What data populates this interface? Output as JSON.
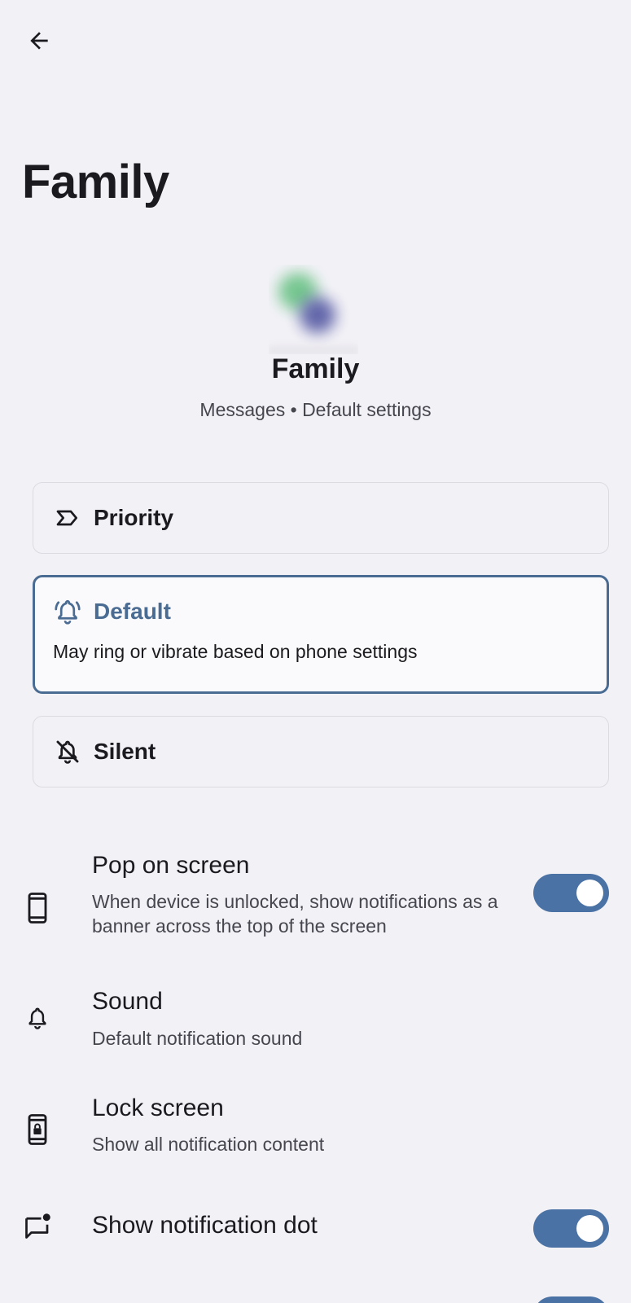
{
  "header": {
    "back_icon": "arrow-back-icon",
    "title": "Family"
  },
  "contact": {
    "name": "Family",
    "subtitle": "Messages • Default settings"
  },
  "importance": {
    "options": [
      {
        "label": "Priority",
        "icon": "priority-icon",
        "selected": false
      },
      {
        "label": "Default",
        "icon": "bell-ring-icon",
        "selected": true,
        "description": "May ring or vibrate based on phone settings"
      },
      {
        "label": "Silent",
        "icon": "bell-off-icon",
        "selected": false
      }
    ]
  },
  "settings": {
    "pop_on_screen": {
      "title": "Pop on screen",
      "subtitle": "When device is unlocked, show notifications as a banner across the top of the screen",
      "icon": "phone-icon",
      "enabled": true
    },
    "sound": {
      "title": "Sound",
      "subtitle": "Default notification sound",
      "icon": "bell-icon"
    },
    "lock_screen": {
      "title": "Lock screen",
      "subtitle": "Show all notification content",
      "icon": "phone-lock-icon"
    },
    "notification_dot": {
      "title": "Show notification dot",
      "icon": "chat-dot-icon",
      "enabled": true
    }
  },
  "colors": {
    "background": "#f2f1f6",
    "accent": "#4a72a4",
    "selected_border": "#4a6b92"
  }
}
